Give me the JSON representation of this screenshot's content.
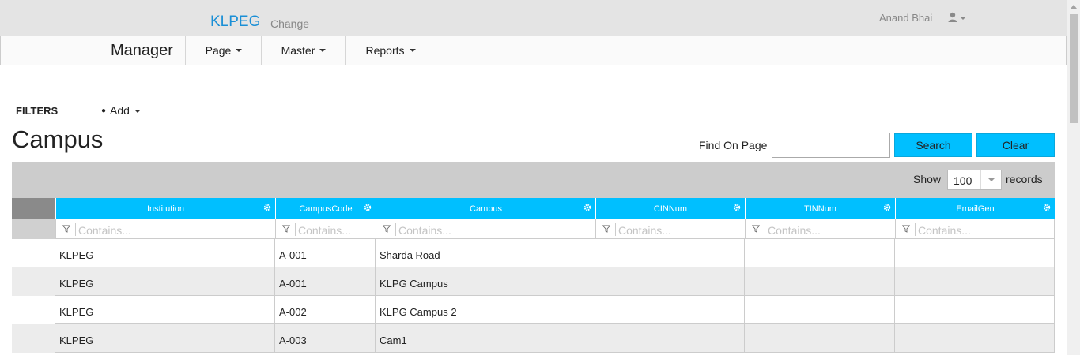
{
  "header": {
    "brand": "KLPEG",
    "change_label": "Change",
    "user_name": "Anand Bhai"
  },
  "navbar": {
    "title": "Manager",
    "items": [
      {
        "label": "Page"
      },
      {
        "label": "Master"
      },
      {
        "label": "Reports"
      }
    ]
  },
  "filters": {
    "label": "FILTERS",
    "add_label": "Add"
  },
  "page": {
    "title": "Campus",
    "find_label": "Find On Page",
    "find_value": "",
    "search_label": "Search",
    "clear_label": "Clear"
  },
  "grid": {
    "show_label": "Show",
    "page_size": "100",
    "records_label": "records",
    "filter_placeholder": "Contains...",
    "columns": [
      "Institution",
      "CampusCode",
      "Campus",
      "CINNum",
      "TINNum",
      "EmailGen"
    ],
    "rows": [
      [
        "KLPEG",
        "A-001",
        "Sharda Road",
        "",
        "",
        ""
      ],
      [
        "KLPEG",
        "A-001",
        "KLPG Campus",
        "",
        "",
        ""
      ],
      [
        "KLPEG",
        "A-002",
        "KLPG Campus 2",
        "",
        "",
        ""
      ],
      [
        "KLPEG",
        "A-003",
        "Cam1",
        "",
        "",
        ""
      ]
    ]
  },
  "colors": {
    "accent": "#00bfff",
    "brand": "#1a8fd6",
    "toolbar": "#cccccc"
  }
}
